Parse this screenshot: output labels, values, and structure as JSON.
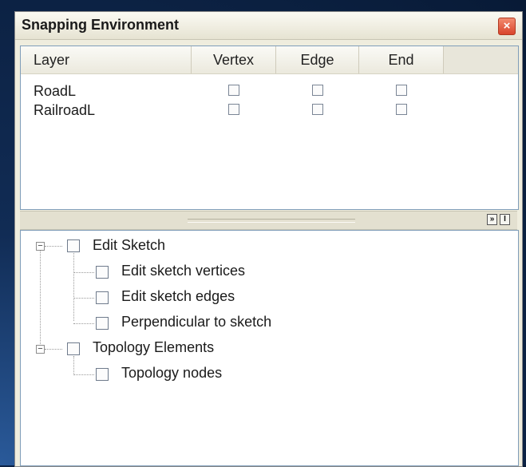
{
  "window": {
    "title": "Snapping Environment",
    "close_icon": "×"
  },
  "layer_table": {
    "columns": [
      "Layer",
      "Vertex",
      "Edge",
      "End"
    ],
    "rows": [
      {
        "name": "RoadL",
        "vertex": false,
        "edge": false,
        "end": false
      },
      {
        "name": "RailroadL",
        "vertex": false,
        "edge": false,
        "end": false
      }
    ]
  },
  "splitter": {
    "collapse_icon": "»",
    "restore_icon": "I"
  },
  "tree": {
    "groups": [
      {
        "label": "Edit Sketch",
        "expander": "−",
        "children": [
          {
            "label": "Edit sketch vertices"
          },
          {
            "label": "Edit sketch edges"
          },
          {
            "label": "Perpendicular to sketch"
          }
        ]
      },
      {
        "label": "Topology Elements",
        "expander": "−",
        "children": [
          {
            "label": "Topology nodes"
          }
        ]
      }
    ]
  }
}
